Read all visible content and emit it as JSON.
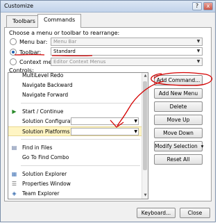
{
  "window": {
    "title": "Customize",
    "help": "?",
    "close": "x"
  },
  "tabs": [
    {
      "label": "Toolbars"
    },
    {
      "label": "Commands"
    }
  ],
  "rearrange": {
    "prompt": "Choose a menu or toolbar to rearrange:",
    "menu_bar": {
      "label": "Menu bar:",
      "value": "Menu Bar"
    },
    "toolbar": {
      "label": "Toolbar:",
      "value": "Standard"
    },
    "context_menu": {
      "label": "Context menu:",
      "value": "Editor Context Menus"
    }
  },
  "controls": {
    "label": "Controls:",
    "items": [
      {
        "label": "MultiLevel Redo"
      },
      {
        "label": "Navigate Backward"
      },
      {
        "label": "Navigate Forward"
      },
      {
        "label": "Start / Continue"
      },
      {
        "label": "Solution Configurations"
      },
      {
        "label": "Solution Platforms"
      },
      {
        "label": "Find in Files"
      },
      {
        "label": "Go To Find Combo"
      },
      {
        "label": "Solution Explorer"
      },
      {
        "label": "Properties Window"
      },
      {
        "label": "Team Explorer"
      }
    ]
  },
  "buttons": {
    "add_command": "Add Command...",
    "add_new_menu": "Add New Menu",
    "delete": "Delete",
    "move_up": "Move Up",
    "move_down": "Move Down",
    "modify_selection": "Modify Selection",
    "reset_all": "Reset All",
    "keyboard": "Keyboard...",
    "close": "Close"
  },
  "icons": {
    "start": "play-icon",
    "find_in_files": "find-in-files-icon",
    "solution_explorer": "solution-explorer-icon",
    "properties_window": "properties-icon",
    "team_explorer": "team-explorer-icon"
  },
  "colors": {
    "annotation": "#d40000",
    "selection": "#fff5c4",
    "accent": "#1b5fb0"
  }
}
